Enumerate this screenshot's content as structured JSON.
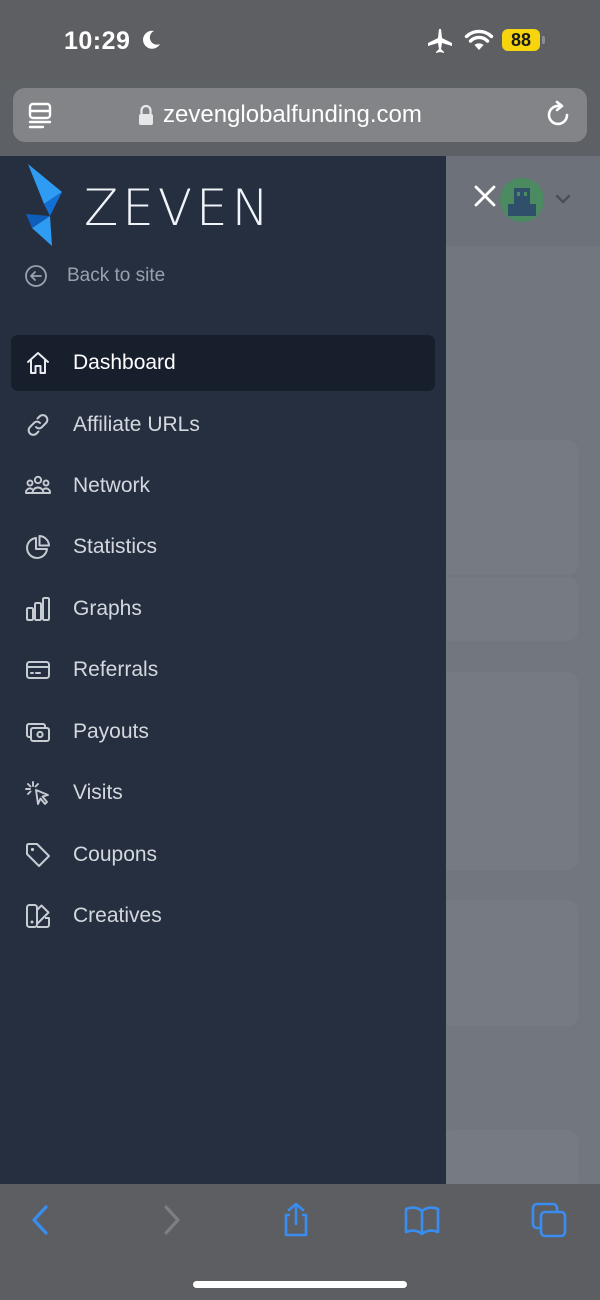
{
  "status_bar": {
    "time": "10:29",
    "battery": "88"
  },
  "browser": {
    "url": "zevenglobalfunding.com"
  },
  "sidebar": {
    "logo_text": "ZEVEN",
    "back_label": "Back to site",
    "items": [
      {
        "label": "Dashboard",
        "icon": "home-icon",
        "active": true
      },
      {
        "label": "Affiliate URLs",
        "icon": "link-icon"
      },
      {
        "label": "Network",
        "icon": "users-icon"
      },
      {
        "label": "Statistics",
        "icon": "pie-chart-icon"
      },
      {
        "label": "Graphs",
        "icon": "bar-chart-icon"
      },
      {
        "label": "Referrals",
        "icon": "credit-card-icon"
      },
      {
        "label": "Payouts",
        "icon": "cash-icon"
      },
      {
        "label": "Visits",
        "icon": "cursor-click-icon"
      },
      {
        "label": "Coupons",
        "icon": "tag-icon"
      },
      {
        "label": "Creatives",
        "icon": "swatch-icon"
      }
    ]
  },
  "colors": {
    "sidebar_bg": "#252f40",
    "active_item_bg": "#171e2c",
    "logo_accent": "#1e8ff0",
    "toolbar_accent": "#3a8df0",
    "battery": "#f6d40e"
  }
}
